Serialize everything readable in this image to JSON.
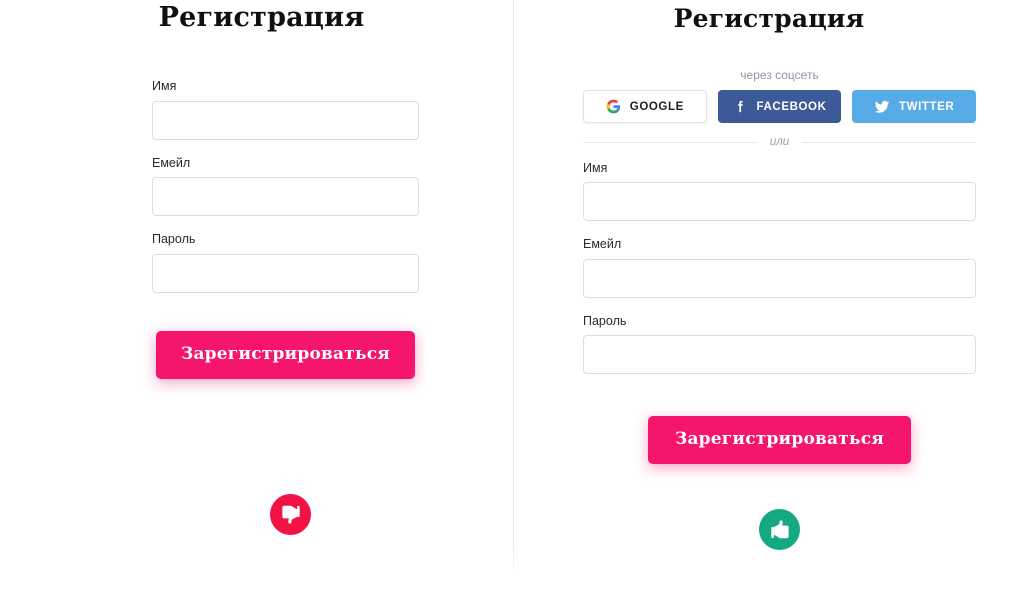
{
  "page": {
    "background": "#ffffff",
    "accent_pink": "#f5156c",
    "divider_color": "#e6e6e6"
  },
  "left_panel": {
    "title": "Регистрация",
    "fields": [
      {
        "label": "Имя",
        "value": "",
        "placeholder": ""
      },
      {
        "label": "Емейл",
        "value": "",
        "placeholder": ""
      },
      {
        "label": "Пароль",
        "value": "",
        "placeholder": ""
      }
    ],
    "submit_label": "Зарегистрироваться",
    "status": {
      "icon": "thumbs-down-icon",
      "color": "#f01343"
    }
  },
  "right_panel": {
    "title": "Регистрация",
    "social": {
      "caption": "через соцсеть",
      "buttons": [
        {
          "label": "GOOGLE",
          "icon": "google-icon",
          "background": "#ffffff",
          "text_color": "#1f1f1f"
        },
        {
          "label": "FACEBOOK",
          "icon": "facebook-icon",
          "background": "#3d5a98",
          "text_color": "#ffffff"
        },
        {
          "label": "TWITTER",
          "icon": "twitter-icon",
          "background": "#57ace8",
          "text_color": "#ffffff"
        }
      ],
      "divider_label": "или"
    },
    "fields": [
      {
        "label": "Имя",
        "value": "",
        "placeholder": ""
      },
      {
        "label": "Емейл",
        "value": "",
        "placeholder": ""
      },
      {
        "label": "Пароль",
        "value": "",
        "placeholder": ""
      }
    ],
    "submit_label": "Зарегистрироваться",
    "status": {
      "icon": "thumbs-up-icon",
      "color": "#15a981"
    }
  }
}
